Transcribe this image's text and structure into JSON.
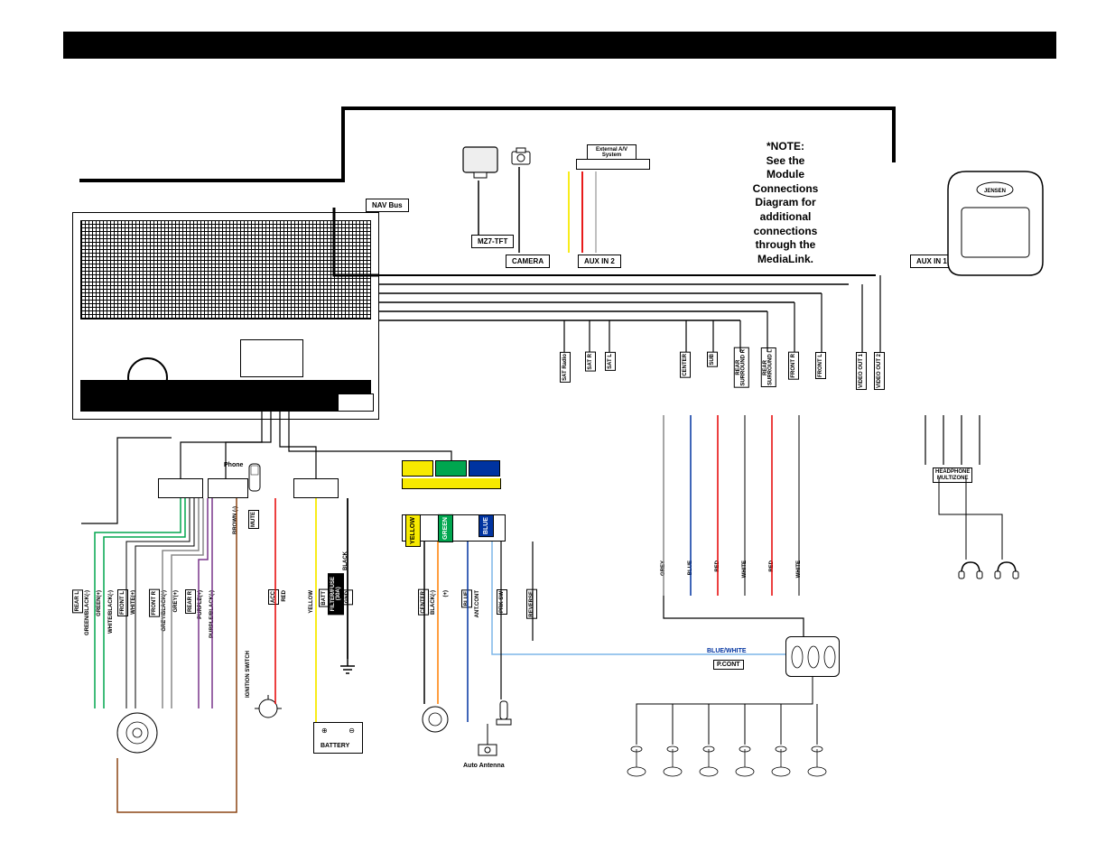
{
  "brand": "JENSEN",
  "note": "*NOTE:\nSee the\nModule\nConnections\nDiagram for\nadditional\nconnections\nthrough the\nMediaLink.",
  "labels": {
    "nav_bus": "NAV Bus",
    "mz7_tft": "MZ7-TFT",
    "camera": "CAMERA",
    "aux_in_2": "AUX IN 2",
    "aux_in_1": "AUX IN 1",
    "external_av": "External\nA/V System",
    "headphone_multizone": "HEADPHONE\nMULTIZONE",
    "phone": "Phone",
    "auto_antenna": "Auto Antenna",
    "battery": "BATTERY",
    "ignition_switch": "IGNITION SWITCH",
    "filter_fuse": "FILTER/FUSE\n(30A)"
  },
  "wire_labels_vertical": {
    "rear_l": "REAR L",
    "green_black_minus": "GREEN/BLACK(-)",
    "green_plus": "GREEN(+)",
    "white_black_minus": "WHITE/BLACK(-)",
    "front_l": "FRONT L",
    "white_plus": "WHITE(+)",
    "front_r": "FRONT R",
    "grey_black_minus": "GREY/BLACK(-)",
    "grey_plus": "GREY(+)",
    "rear_r": "REAR R",
    "purple_plus": "PURPLE(+)",
    "purple_black_minus": "PURPLE/BLACK(-)",
    "brown_minus": "BROWN (-)",
    "mute": "MUTE",
    "acc": "ACC",
    "red": "RED",
    "yellow_w": "YELLOW",
    "batt": "BATT",
    "black_w": "BLACK",
    "gnd": "GND",
    "yellow": "YELLOW",
    "green": "GREEN",
    "blue": "BLUE",
    "center": "CENTER",
    "black_minus": "BLACK(-)",
    "plus": "(+)",
    "blue_c": "BLUE",
    "ant_cont": "ANT.CONT",
    "prk_sw": "PRK SW",
    "reverse": "REVERSE",
    "sat_radio": "SAT Radio",
    "sat_r": "SAT R",
    "sat_l": "SAT L",
    "center_out": "CENTER",
    "sub": "SUB",
    "rear_surround_r": "REAR\nSURROUND  R",
    "rear_surround_l": "REAR\nSURROUND  L",
    "front_r_out": "FRONT R",
    "front_l_out": "FRONT L",
    "video_out_1": "VIDEO OUT 1",
    "video_out_2": "VIDEO OUT 2",
    "grey_rca": "GREY",
    "blue_rca": "BLUE",
    "red_rca": "RED",
    "white_rca": "WHITE",
    "red_rca2": "RED",
    "white_rca2": "WHITE"
  },
  "wire_labels_horizontal": {
    "blue_white": "BLUE/WHITE",
    "p_cont": "P.CONT"
  },
  "colors": {
    "yellow": "#f7ea00",
    "green": "#00a64f",
    "blue": "#0033a0",
    "red": "#e60000",
    "orange": "#ff7f00",
    "brown": "#8b4513",
    "purple": "#7a378b",
    "grey": "#888888",
    "black": "#000000",
    "lightblue": "#7db6e8"
  }
}
